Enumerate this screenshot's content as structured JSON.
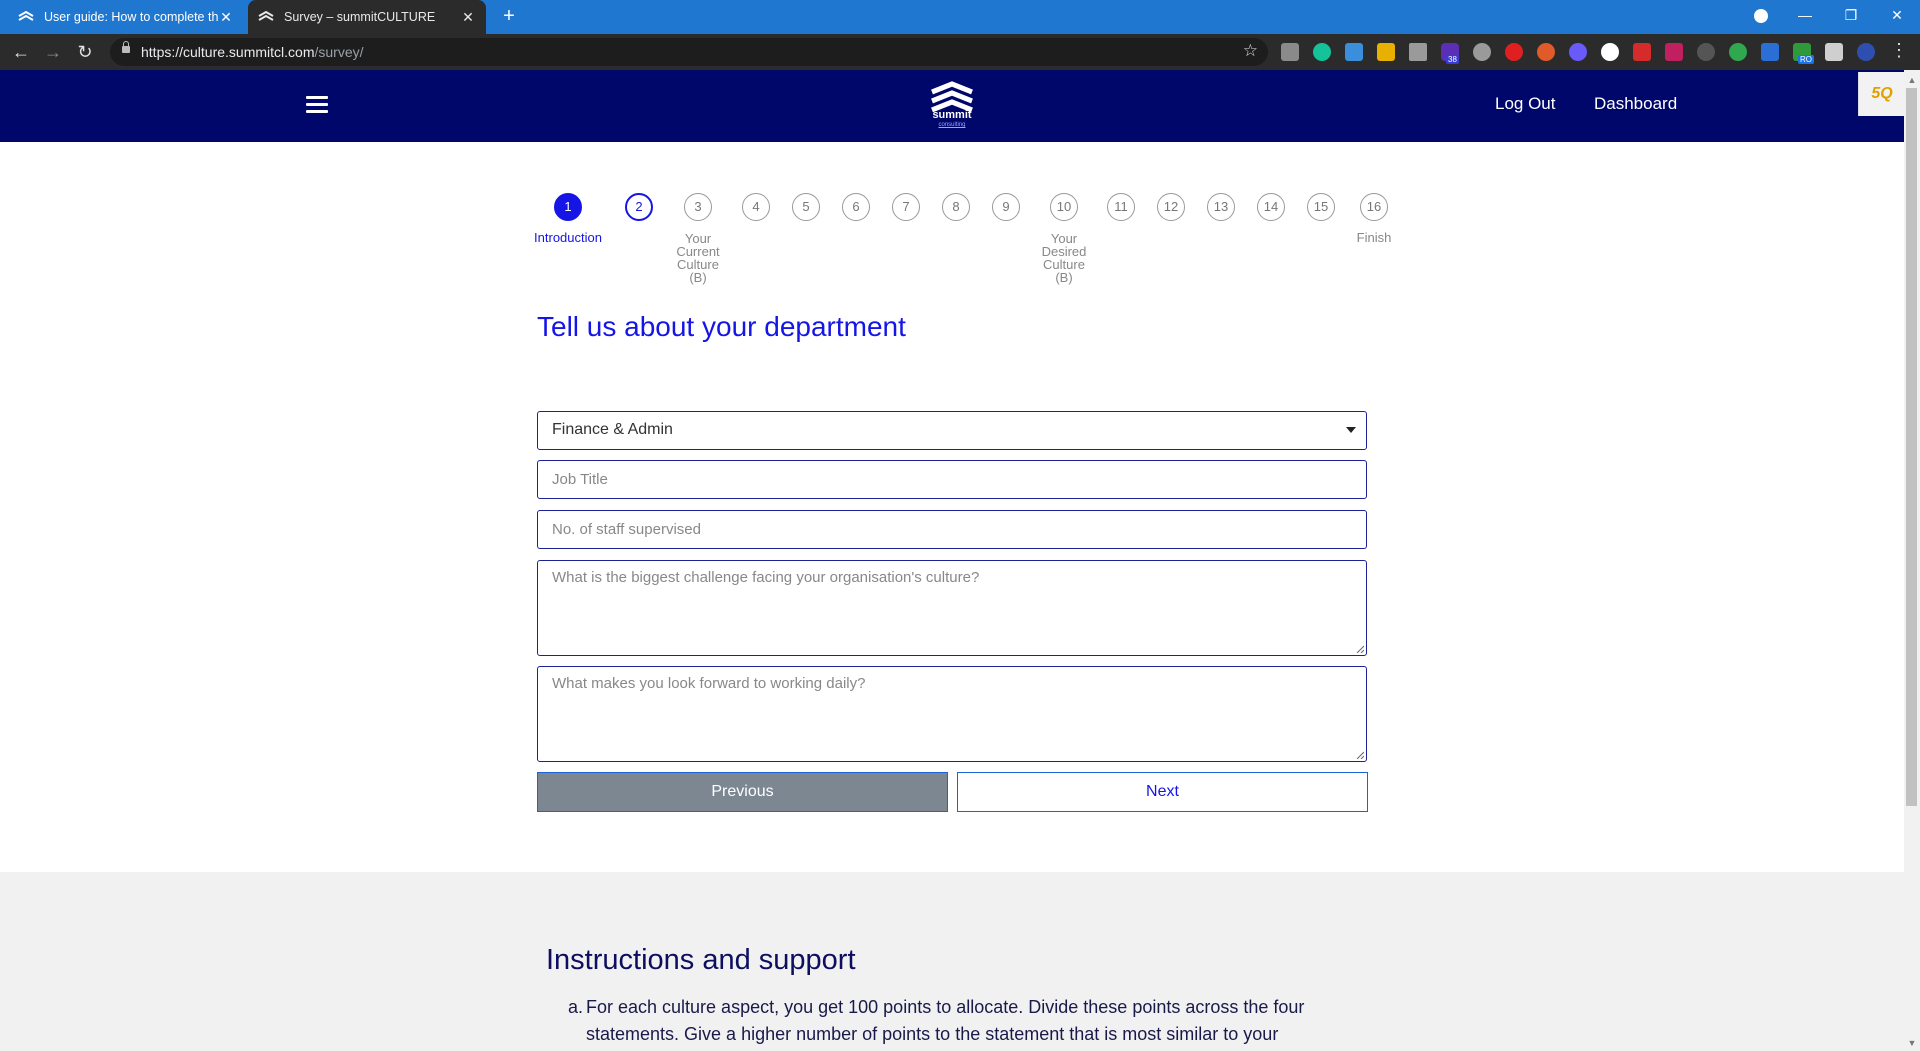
{
  "browser": {
    "tabs": [
      {
        "label": "User guide: How to complete the",
        "active": false
      },
      {
        "label": "Survey – summitCULTURE",
        "active": true
      }
    ],
    "url_host": "https://culture.summitcl.com",
    "url_path": "/survey/",
    "extension_badges": {
      "notes": "38",
      "green": "RO"
    }
  },
  "header": {
    "logo_text": "summit",
    "logo_subtext": "consulting",
    "links": [
      "Log Out",
      "Dashboard"
    ],
    "side_badge": "5Q",
    "bg_color": "#00076b"
  },
  "stepper": {
    "current": 1,
    "steps": [
      "1",
      "2",
      "3",
      "4",
      "5",
      "6",
      "7",
      "8",
      "9",
      "10",
      "11",
      "12",
      "13",
      "14",
      "15",
      "16"
    ],
    "labels": {
      "step1": "Introduction",
      "step3": "Your Current Culture (B)",
      "step10": "Your Desired Culture (B)",
      "step16": "Finish"
    },
    "accent_color": "#1515e6"
  },
  "form": {
    "title": "Tell us about your department",
    "department_selected": "Finance & Admin",
    "job_title_placeholder": "Job Title",
    "staff_placeholder": "No. of staff supervised",
    "challenge_placeholder": "What is the biggest challenge facing your organisation's culture?",
    "forward_placeholder": "What makes you look forward to working daily?",
    "previous_label": "Previous",
    "next_label": "Next"
  },
  "support": {
    "heading": "Instructions and support",
    "items": [
      {
        "marker": "a.",
        "text": "For each culture aspect, you get 100 points to allocate. Divide these points across the four statements. Give a higher number of points to the statement that is most similar to your"
      }
    ]
  }
}
